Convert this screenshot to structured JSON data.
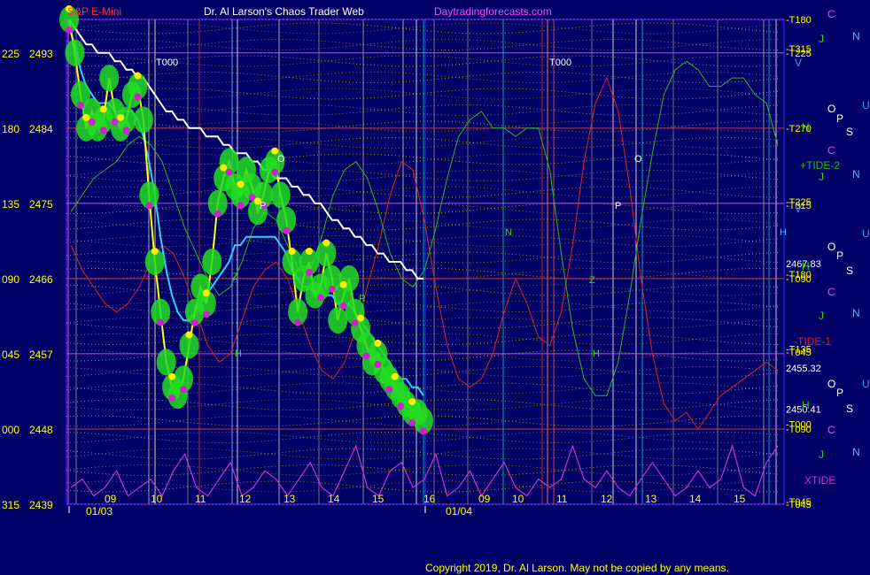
{
  "header": {
    "instrument": "S&P E-Mini",
    "title": "Dr. Al Larson's Chaos Trader Web",
    "site": "Daytradingforecasts.com"
  },
  "footer": {
    "copyright": "Copyright 2019, Dr. Al Larson. May not be copied by any means."
  },
  "colors": {
    "background": "#000066",
    "price": "#ffff00",
    "average_fast": "#33ccff",
    "average_slow": "#ffffff",
    "tide_1": "#dd2222",
    "tide_2": "#22bb22",
    "xtide": "#cc33cc",
    "green_band": "#22dd22",
    "magenta_dot": "#cc22cc",
    "yellow_dot": "#ffee00"
  },
  "chart_data": {
    "type": "line",
    "title": "S&P E-Mini",
    "y_left_angles": [
      "225",
      "180",
      "135",
      "090",
      "045",
      "000",
      "315"
    ],
    "y_prices": [
      2493,
      2484,
      2475,
      2466,
      2457,
      2448,
      2439
    ],
    "ylim": [
      2439,
      2497
    ],
    "x_hours": [
      "09",
      "10",
      "11",
      "12",
      "13",
      "14",
      "15",
      "16",
      "09",
      "10",
      "11",
      "12",
      "13",
      "14",
      "15"
    ],
    "dates": [
      "01/03",
      "01/04"
    ],
    "right_axis_labels": [
      {
        "text": "-T180",
        "price": 2497
      },
      {
        "text": "-T315",
        "price": 2493.5
      },
      {
        "text": "-T225",
        "price": 2493
      },
      {
        "text": "-T270",
        "price": 2484
      },
      {
        "text": "-T225",
        "price": 2475.2
      },
      {
        "text": "-T315",
        "price": 2474.8
      },
      {
        "text": "2467.83",
        "price": 2467.8
      },
      {
        "text": "-T180",
        "price": 2466.5
      },
      {
        "text": "-T090",
        "price": 2466
      },
      {
        "text": "-T135",
        "price": 2457.6
      },
      {
        "text": "-T045",
        "price": 2457.2
      },
      {
        "text": "2455.32",
        "price": 2455.3
      },
      {
        "text": "2450.41",
        "price": 2450.4
      },
      {
        "text": "-T000",
        "price": 2448.6
      },
      {
        "text": "-T090",
        "price": 2448
      },
      {
        "text": "-T045",
        "price": 2439.3
      },
      {
        "text": "-T045",
        "price": 2439
      }
    ],
    "right_markers": [
      "C",
      "J",
      "N",
      "V",
      "O",
      "P",
      "S",
      "U",
      "H",
      "C",
      "J",
      "N",
      "V",
      "O",
      "P",
      "S",
      "U",
      "H",
      "C",
      "J",
      "N",
      "O",
      "P",
      "S",
      "U",
      "H",
      "C",
      "J",
      "N"
    ],
    "legend": [
      "+TIDE-2",
      "-TIDE-1",
      "XTIDE"
    ],
    "chart_marks": [
      "T000",
      "T000",
      "O",
      "P",
      "Z",
      "R",
      "N",
      "O",
      "P",
      "Z",
      "H",
      "H",
      "H"
    ],
    "series": [
      {
        "name": "price",
        "values": [
          2497,
          2493,
          2488,
          2484,
          2486,
          2484,
          2485,
          2490,
          2486,
          2484,
          2485,
          2488,
          2489,
          2485,
          2476,
          2468,
          2462,
          2456,
          2453,
          2452,
          2454,
          2458,
          2462,
          2465,
          2463,
          2468,
          2475,
          2478,
          2480,
          2477,
          2476,
          2479,
          2477,
          2474,
          2476,
          2479,
          2480,
          2476,
          2473,
          2468,
          2462,
          2466,
          2468,
          2464,
          2465,
          2469,
          2466,
          2461,
          2464,
          2466,
          2462,
          2460,
          2458,
          2456,
          2457,
          2455,
          2454,
          2453,
          2452,
          2451,
          2450,
          2450,
          2449
        ]
      },
      {
        "name": "average_fast",
        "values": [
          2496,
          2494,
          2491,
          2489,
          2488,
          2487,
          2487,
          2487,
          2486,
          2486,
          2486,
          2486,
          2485,
          2483,
          2480,
          2476,
          2471,
          2467,
          2464,
          2462,
          2461,
          2461,
          2462,
          2463,
          2464,
          2465,
          2466,
          2467,
          2468,
          2470,
          2470,
          2471,
          2471,
          2471,
          2471,
          2471,
          2471,
          2470,
          2469,
          2467,
          2466,
          2465,
          2465,
          2464,
          2464,
          2464,
          2464,
          2463,
          2463,
          2463,
          2462,
          2461,
          2460,
          2459,
          2458,
          2457,
          2456,
          2455,
          2454,
          2454,
          2453,
          2453,
          2452
        ]
      },
      {
        "name": "average_slow",
        "values": [
          2497,
          2496,
          2495,
          2494,
          2494,
          2493,
          2493,
          2493,
          2492,
          2492,
          2491,
          2491,
          2490,
          2490,
          2489,
          2488,
          2487,
          2486,
          2486,
          2485,
          2485,
          2484,
          2484,
          2484,
          2483,
          2483,
          2483,
          2482,
          2482,
          2481,
          2481,
          2481,
          2480,
          2480,
          2479,
          2479,
          2478,
          2478,
          2478,
          2477,
          2477,
          2476,
          2476,
          2475,
          2475,
          2474,
          2473,
          2473,
          2472,
          2472,
          2471,
          2471,
          2470,
          2470,
          2469,
          2469,
          2468,
          2468,
          2468,
          2467,
          2467,
          2466,
          2466
        ]
      },
      {
        "name": "TIDE-2",
        "values": [
          2474,
          2476,
          2478,
          2479,
          2480,
          2482,
          2483,
          2482,
          2480,
          2476,
          2472,
          2469,
          2466,
          2464,
          2465,
          2468,
          2472,
          2474,
          2473,
          2470,
          2467,
          2467,
          2471,
          2476,
          2479,
          2480,
          2478,
          2474,
          2469,
          2466,
          2465,
          2467,
          2472,
          2478,
          2483,
          2485,
          2486,
          2484,
          2484,
          2483,
          2484,
          2484,
          2479,
          2469,
          2460,
          2454,
          2452,
          2452,
          2456,
          2464,
          2473,
          2481,
          2488,
          2491,
          2492,
          2491,
          2489,
          2489,
          2490,
          2490,
          2488,
          2487,
          2482
        ]
      },
      {
        "name": "TIDE-1",
        "values": [
          2470,
          2467,
          2465,
          2463,
          2462,
          2463,
          2465,
          2468,
          2470,
          2469,
          2466,
          2462,
          2458,
          2456,
          2457,
          2461,
          2465,
          2467,
          2468,
          2466,
          2462,
          2458,
          2455,
          2454,
          2456,
          2460,
          2465,
          2470,
          2476,
          2480,
          2479,
          2473,
          2465,
          2458,
          2454,
          2453,
          2454,
          2457,
          2462,
          2466,
          2463,
          2459,
          2458,
          2462,
          2470,
          2480,
          2487,
          2490,
          2486,
          2477,
          2466,
          2457,
          2451,
          2449,
          2450,
          2448,
          2450,
          2452,
          2453,
          2454,
          2455,
          2456,
          2455
        ]
      },
      {
        "name": "XTIDE",
        "values": [
          2441,
          2442,
          2440,
          2441,
          2443,
          2440,
          2441,
          2442,
          2440,
          2443,
          2445,
          2441,
          2440,
          2442,
          2444,
          2440,
          2441,
          2443,
          2442,
          2440,
          2442,
          2444,
          2441,
          2440,
          2443,
          2446,
          2441,
          2440,
          2443,
          2444,
          2441,
          2442,
          2445,
          2440,
          2441,
          2443,
          2440,
          2442,
          2444,
          2441,
          2440,
          2442,
          2441,
          2442,
          2446,
          2442,
          2441,
          2443,
          2441,
          2440,
          2442,
          2444,
          2442,
          2440,
          2441,
          2443,
          2441,
          2442,
          2446,
          2441,
          2440,
          2444,
          2446
        ]
      }
    ]
  }
}
